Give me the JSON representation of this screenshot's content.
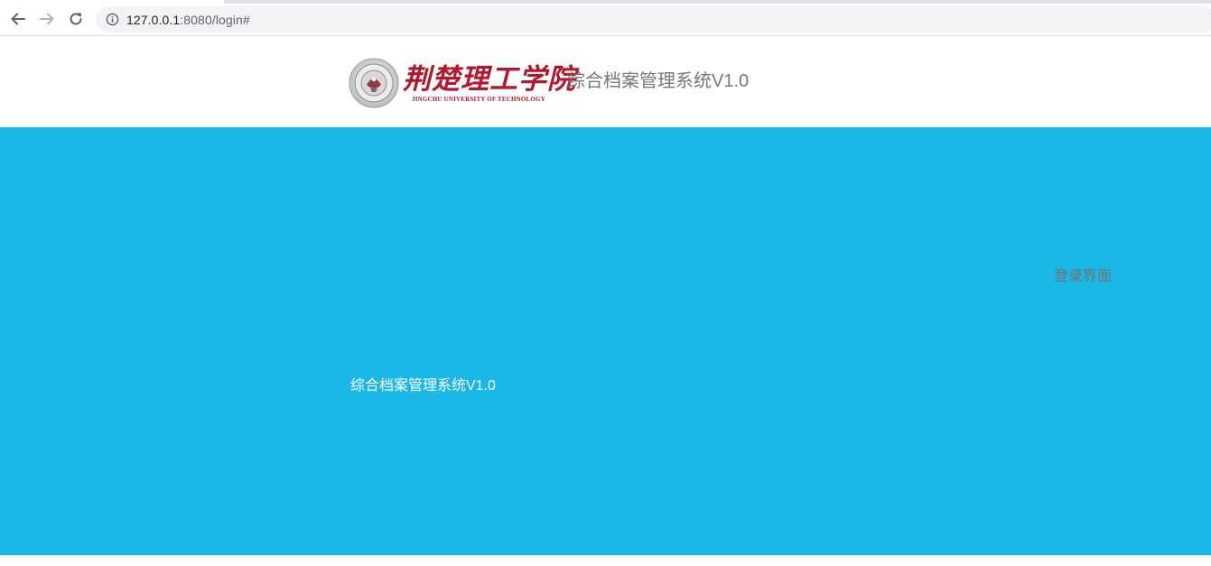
{
  "browser": {
    "url_host": "127.0.0.1",
    "url_rest": ":8080/login#"
  },
  "header": {
    "school_name_cn": "荆楚理工学院",
    "school_name_en": "JINGCHU UNIVERSITY OF TECHNOLOGY",
    "title": "综合档案管理系统V1.0"
  },
  "main": {
    "login_label": "登录界面",
    "system_name": "综合档案管理系统V1.0"
  },
  "colors": {
    "panel_bg": "#1ab8e6",
    "brand_red": "#b3172c"
  },
  "icons": {
    "back": "arrow-left-icon",
    "forward": "arrow-right-icon",
    "reload": "reload-icon",
    "site_info": "info-icon",
    "seal": "university-seal-logo"
  }
}
